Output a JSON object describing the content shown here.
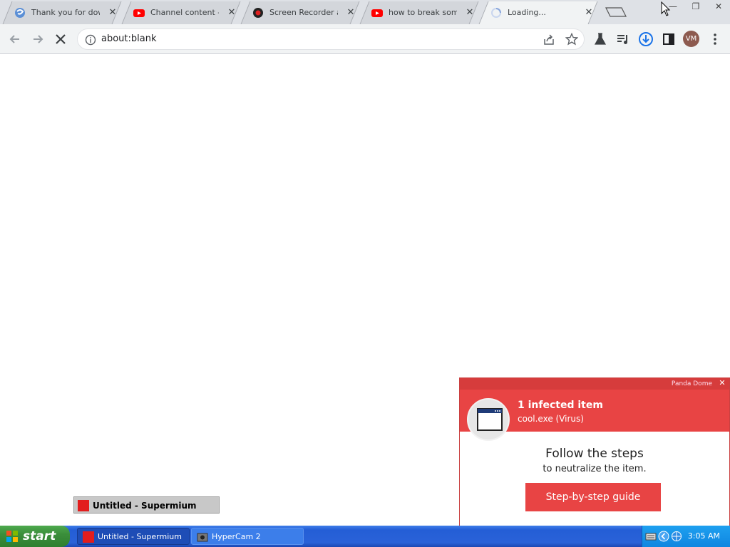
{
  "browser": {
    "tabs": [
      {
        "title": "Thank you for downl",
        "favicon": "blue-swirl-icon",
        "active": false
      },
      {
        "title": "Channel content - Y",
        "favicon": "youtube-icon",
        "active": false
      },
      {
        "title": "Screen Recorder an",
        "favicon": "record-icon",
        "active": false
      },
      {
        "title": "how to break someo",
        "favicon": "youtube-icon",
        "active": false
      },
      {
        "title": "Loading...",
        "favicon": "spinner-icon",
        "active": true
      }
    ],
    "address_bar": {
      "url": "about:blank"
    },
    "profile_initials": "VM"
  },
  "popup": {
    "brand": "Panda Dome",
    "heading": "1 infected item",
    "file": "cool.exe (Virus)",
    "instruction": "Follow the steps",
    "instruction_sub": "to neutralize the item.",
    "button_label": "Step-by-step guide",
    "colors": {
      "accent": "#e84444"
    }
  },
  "minimized_window": {
    "label": "Untitled - Supermium"
  },
  "taskbar": {
    "start_label": "start",
    "tasks": [
      {
        "label": "Untitled - Supermium",
        "active": true
      },
      {
        "label": "HyperCam 2",
        "active": false
      }
    ],
    "clock": "3:05 AM"
  }
}
